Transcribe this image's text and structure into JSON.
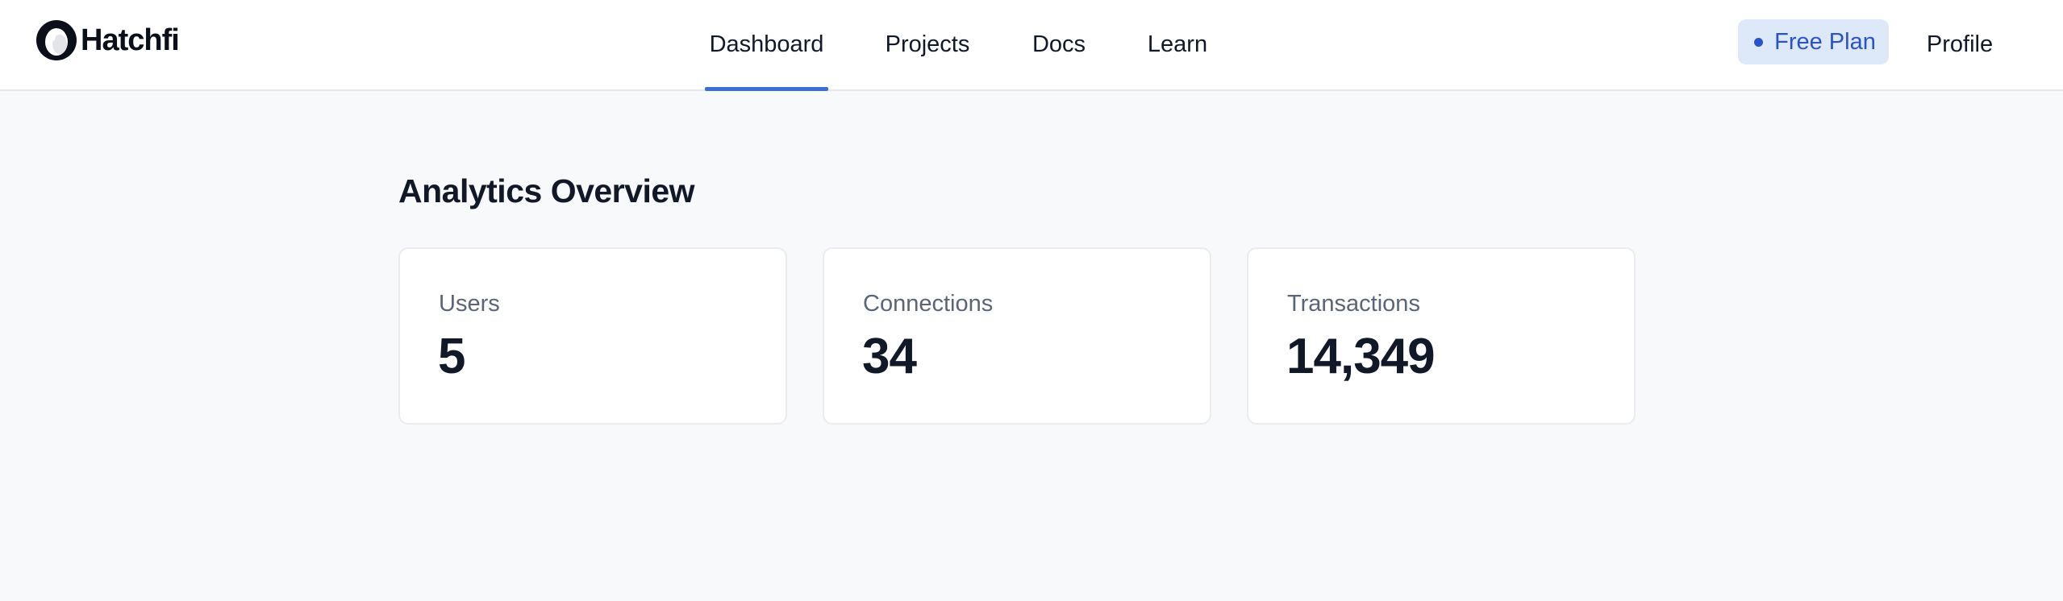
{
  "brand": {
    "name": "Hatchfi",
    "logo_icon": "egg-logo-icon"
  },
  "nav": {
    "items": [
      {
        "label": "Dashboard",
        "active": true
      },
      {
        "label": "Projects",
        "active": false
      },
      {
        "label": "Docs",
        "active": false
      },
      {
        "label": "Learn",
        "active": false
      }
    ]
  },
  "account": {
    "plan_label": "Free Plan",
    "profile_label": "Profile"
  },
  "main": {
    "title": "Analytics Overview",
    "stats": [
      {
        "label": "Users",
        "value": "5"
      },
      {
        "label": "Connections",
        "value": "34"
      },
      {
        "label": "Transactions",
        "value": "14,349"
      }
    ]
  },
  "colors": {
    "accent": "#3b6fd8",
    "badge_bg": "#dde8f8",
    "badge_text": "#2a53c8",
    "page_bg": "#f8f9fb",
    "muted_text": "#5b6577"
  }
}
